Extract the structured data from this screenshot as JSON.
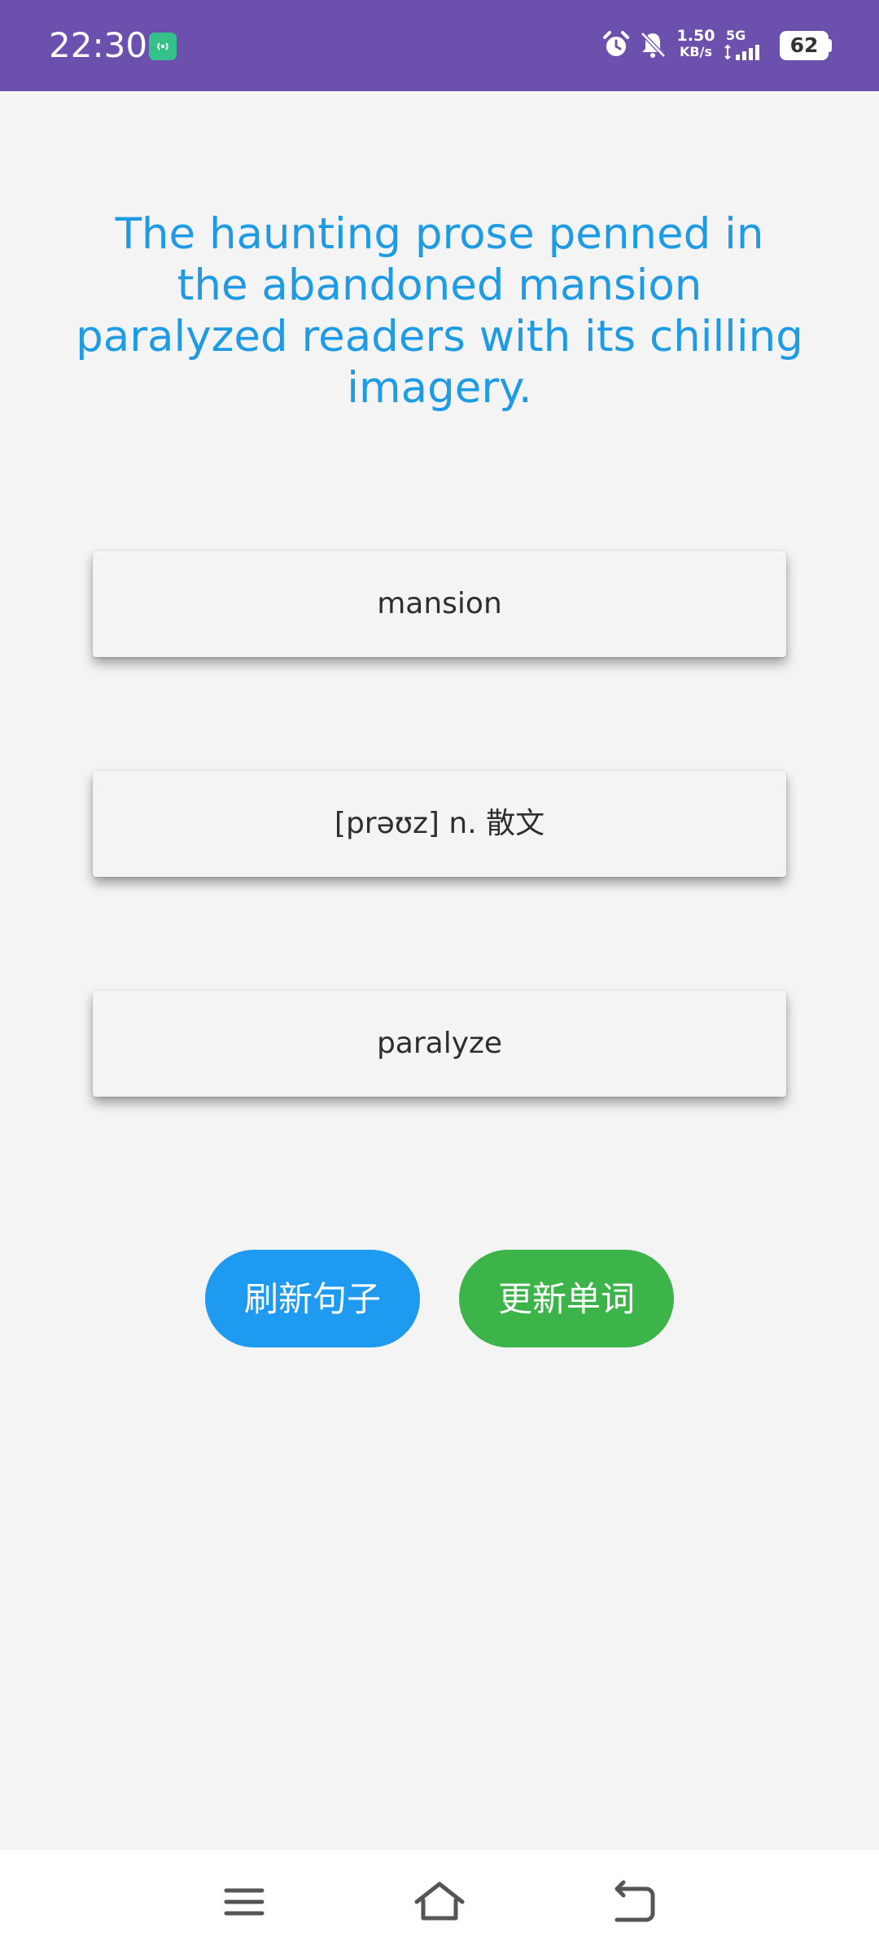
{
  "status_bar": {
    "time": "22:30",
    "net_speed_value": "1.50",
    "net_speed_unit": "KB/s",
    "network_type": "5G",
    "battery": "62",
    "background_color": "#6b51ad",
    "icons": [
      "hotspot-icon",
      "alarm-icon",
      "bell-off-icon",
      "signal-icon",
      "battery-icon"
    ]
  },
  "sentence": "The haunting prose penned in the abandoned mansion paralyzed readers with its chilling imagery.",
  "cards": [
    {
      "text": "mansion"
    },
    {
      "text": "[prəʊz] n. 散文"
    },
    {
      "text": "paralyze"
    }
  ],
  "actions": {
    "refresh_label": "刷新句子",
    "update_label": "更新单词",
    "refresh_color": "#1e9bf0",
    "update_color": "#3cb449"
  },
  "nav": {
    "icons": [
      "menu-icon",
      "home-icon",
      "back-icon"
    ]
  },
  "colors": {
    "sentence": "#1f9be6",
    "background": "#f4f4f4"
  }
}
